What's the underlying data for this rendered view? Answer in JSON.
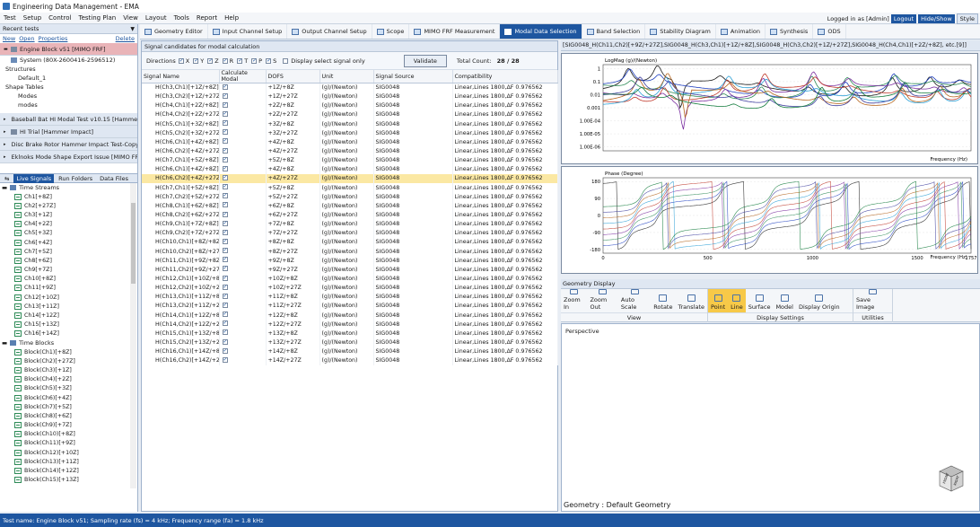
{
  "app": {
    "title": "Engineering Data Management - EMA"
  },
  "menu": [
    "Test",
    "Setup",
    "Control",
    "Testing Plan",
    "View",
    "Layout",
    "Tools",
    "Report",
    "Help"
  ],
  "user": {
    "logged_in": "Logged in as [Admin]",
    "logout": "Logout",
    "hide_show": "Hide/Show",
    "style": "Style"
  },
  "tool_tabs": [
    "Geometry Editor",
    "Input Channel Setup",
    "Output Channel Setup",
    "Scope",
    "MIMO FRF Measurement",
    "Modal Data Selection",
    "Band Selection",
    "Stability Diagram",
    "Animation",
    "Synthesis",
    "ODS"
  ],
  "left": {
    "recent_header": "Recent tests",
    "cmd_new": "New",
    "cmd_open": "Open",
    "cmd_properties": "Properties",
    "cmd_delete": "Delete",
    "selected_test": "Engine Block v51   [MIMO FRF]",
    "system": "System (80X-2600416-2596512)",
    "structures": "Structures",
    "default": "Default_1",
    "shape_tables": "Shape Tables",
    "modes1": "Modes",
    "modes2": "modes",
    "other_tests": [
      "Baseball Bat HI Modal Test v10.15   [Hammer I",
      "HI Trial   [Hammer Impact]",
      "Disc Brake Rotor Hammer Impact Test-Copy(",
      "Eklnoks Mode Shape Export Issue   [MIMO FRF"
    ],
    "tabs": [
      "Live Signals",
      "Run Folders",
      "Data Files"
    ],
    "time_streams": "Time Streams",
    "streams": [
      "Ch1[+8Z]",
      "Ch2[+27Z]",
      "Ch3[+1Z]",
      "Ch4[+2Z]",
      "Ch5[+3Z]",
      "Ch6[+4Z]",
      "Ch7[+5Z]",
      "Ch8[+6Z]",
      "Ch9[+7Z]",
      "Ch10[+8Z]",
      "Ch11[+9Z]",
      "Ch12[+10Z]",
      "Ch13[+11Z]",
      "Ch14[+12Z]",
      "Ch15[+13Z]",
      "Ch16[+14Z]"
    ],
    "time_blocks": "Time Blocks",
    "blocks": [
      "Block(Ch1)[+8Z]",
      "Block(Ch2)[+27Z]",
      "Block(Ch3)[+1Z]",
      "Block(Ch4)[+2Z]",
      "Block(Ch5)[+3Z]",
      "Block(Ch6)[+4Z]",
      "Block(Ch7)[+5Z]",
      "Block(Ch8)[+6Z]",
      "Block(Ch9)[+7Z]",
      "Block(Ch10)[+8Z]",
      "Block(Ch11)[+9Z]",
      "Block(Ch12)[+10Z]",
      "Block(Ch13)[+11Z]",
      "Block(Ch14)[+12Z]",
      "Block(Ch15)[+13Z]"
    ]
  },
  "signals": {
    "tab": "Signal candidates for modal calculation",
    "directions_label": "Directions",
    "directions": [
      {
        "label": "X",
        "checked": true
      },
      {
        "label": "Y",
        "checked": true
      },
      {
        "label": "Z",
        "checked": true
      },
      {
        "label": "R",
        "checked": true
      },
      {
        "label": "T",
        "checked": true
      },
      {
        "label": "P",
        "checked": true
      },
      {
        "label": "S",
        "checked": true
      }
    ],
    "display_select": "Display select signal only",
    "validate": "Validate",
    "total_label": "Total Count:",
    "total_value": "28 / 28",
    "columns": [
      "Signal Name",
      "Calculate Modal",
      "DOFS",
      "Unit",
      "Signal Source",
      "Compatibility"
    ],
    "unit": "(g)/(Newton)",
    "source": "SIG0048",
    "compat": "Linear,Lines 1800,ΔF 0.976562",
    "highlight_index": 10,
    "rows": [
      [
        "H(Ch3,Ch1)[+1Z/+8Z]",
        "+1Z/+8Z"
      ],
      [
        "H(Ch3,Ch2)[+1Z/+27Z]",
        "+1Z/+27Z"
      ],
      [
        "H(Ch4,Ch1)[+2Z/+8Z]",
        "+2Z/+8Z"
      ],
      [
        "H(Ch4,Ch2)[+2Z/+27Z]",
        "+2Z/+27Z"
      ],
      [
        "H(Ch5,Ch1)[+3Z/+8Z]",
        "+3Z/+8Z"
      ],
      [
        "H(Ch5,Ch2)[+3Z/+27Z]",
        "+3Z/+27Z"
      ],
      [
        "H(Ch6,Ch1)[+4Z/+8Z]",
        "+4Z/+8Z"
      ],
      [
        "H(Ch6,Ch2)[+4Z/+27Z]",
        "+4Z/+27Z"
      ],
      [
        "H(Ch7,Ch1)[+5Z/+8Z]",
        "+5Z/+8Z"
      ],
      [
        "H(Ch6,Ch1)[+4Z/+8Z]",
        "+4Z/+8Z"
      ],
      [
        "H(Ch6,Ch2)[+4Z/+27Z]",
        "+4Z/+27Z"
      ],
      [
        "H(Ch7,Ch1)[+5Z/+8Z]",
        "+5Z/+8Z"
      ],
      [
        "H(Ch7,Ch2)[+5Z/+27Z]",
        "+5Z/+27Z"
      ],
      [
        "H(Ch8,Ch1)[+6Z/+8Z]",
        "+6Z/+8Z"
      ],
      [
        "H(Ch8,Ch2)[+6Z/+27Z]",
        "+6Z/+27Z"
      ],
      [
        "H(Ch9,Ch1)[+7Z/+8Z]",
        "+7Z/+8Z"
      ],
      [
        "H(Ch9,Ch2)[+7Z/+27Z]",
        "+7Z/+27Z"
      ],
      [
        "H(Ch10,Ch1)[+8Z/+8Z]",
        "+8Z/+8Z"
      ],
      [
        "H(Ch10,Ch2)[+8Z/+27Z]",
        "+8Z/+27Z"
      ],
      [
        "H(Ch11,Ch1)[+9Z/+8Z]",
        "+9Z/+8Z"
      ],
      [
        "H(Ch11,Ch2)[+9Z/+27Z]",
        "+9Z/+27Z"
      ],
      [
        "H(Ch12,Ch1)[+10Z/+8Z]",
        "+10Z/+8Z"
      ],
      [
        "H(Ch12,Ch2)[+10Z/+27Z]",
        "+10Z/+27Z"
      ],
      [
        "H(Ch13,Ch1)[+11Z/+8Z]",
        "+11Z/+8Z"
      ],
      [
        "H(Ch13,Ch2)[+11Z/+27Z]",
        "+11Z/+27Z"
      ],
      [
        "H(Ch14,Ch1)[+12Z/+8Z]",
        "+12Z/+8Z"
      ],
      [
        "H(Ch14,Ch2)[+12Z/+27Z]",
        "+12Z/+27Z"
      ],
      [
        "H(Ch15,Ch1)[+13Z/+8Z]",
        "+13Z/+8Z"
      ],
      [
        "H(Ch15,Ch2)[+13Z/+27Z]",
        "+13Z/+27Z"
      ],
      [
        "H(Ch16,Ch1)[+14Z/+8Z]",
        "+14Z/+8Z"
      ],
      [
        "H(Ch16,Ch2)[+14Z/+27Z]",
        "+14Z/+27Z"
      ]
    ]
  },
  "plots": {
    "tab": "[SIG0048_H(Ch11,Ch2)[+9Z/+27Z],SIG0048_H(Ch3,Ch1)[+1Z/+8Z],SIG0048_H(Ch3,Ch2)[+1Z/+27Z],SIG0048_H(Ch4,Ch1)[+2Z/+8Z], etc.[9]]",
    "mag_title": "LogMag (g)/(Newton)",
    "mag_ticks": [
      "1",
      "0.1",
      "0.01",
      "0.001",
      "1.00E-04",
      "1.00E-05",
      "1.00E-06"
    ],
    "phase_title": "Phase (Degree)",
    "phase_ticks": [
      "180",
      "90",
      "0",
      "-90",
      "-180"
    ],
    "x_ticks": [
      "0",
      "500",
      "1000",
      "1500",
      "1757"
    ],
    "xlabel": "Frequency (Hz)"
  },
  "geometry": {
    "tab": "Geometry Display",
    "view_buttons": [
      "Zoom In",
      "Zoom Out",
      "Auto Scale",
      "Rotate",
      "Translate"
    ],
    "view_label": "View",
    "display_buttons": [
      "Point",
      "Line",
      "Surface",
      "Model",
      "Display Origin"
    ],
    "display_label": "Display Settings",
    "util_buttons": [
      "Save Image"
    ],
    "util_label": "Utilities",
    "perspective": "Perspective",
    "name": "Geometry : Default Geometry",
    "cube_front": "FRONT",
    "cube_right": "RIGHT"
  },
  "status": "Test name: Engine Block v51; Sampling rate (fs) = 4 kHz; Frequency range (fa) = 1.8 kHz",
  "colors": {
    "accent": "#1e56a0",
    "highlight": "#fbe8a3",
    "selected_test": "#e9b4b8",
    "active_button": "#f7c948"
  }
}
